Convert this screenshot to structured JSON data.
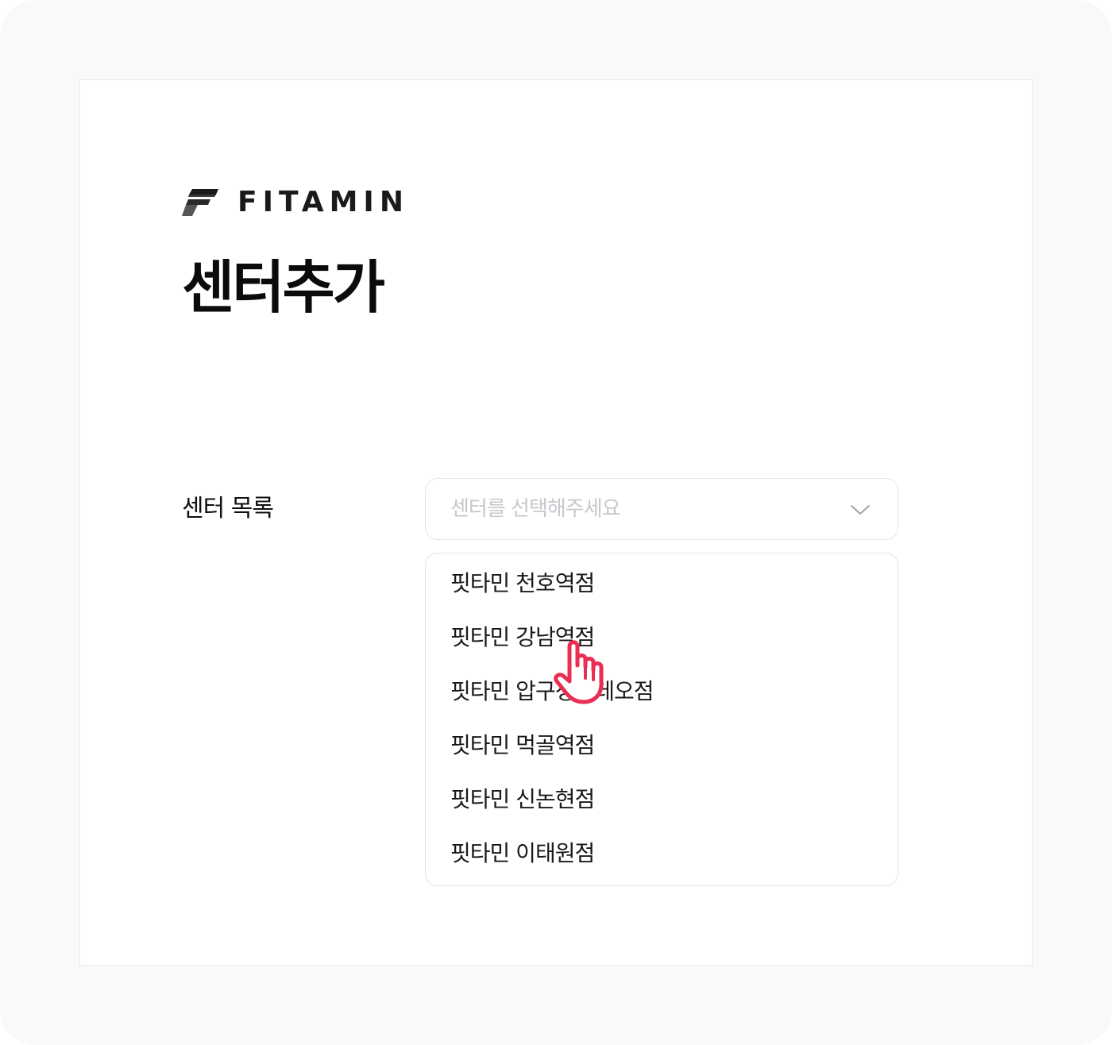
{
  "brand": {
    "name": "FITAMIN"
  },
  "page": {
    "title": "센터추가"
  },
  "form": {
    "center_list_label": "센터 목록",
    "select_placeholder": "센터를 선택해주세요"
  },
  "dropdown": {
    "options": [
      "핏타민 천호역점",
      "핏타민 강남역점",
      "핏타민 압구정로데오점",
      "핏타민 먹골역점",
      "핏타민 신논현점",
      "핏타민 이태원점"
    ]
  },
  "cursor": {
    "icon": "hand-pointer-icon",
    "color": "#ea2e52"
  }
}
